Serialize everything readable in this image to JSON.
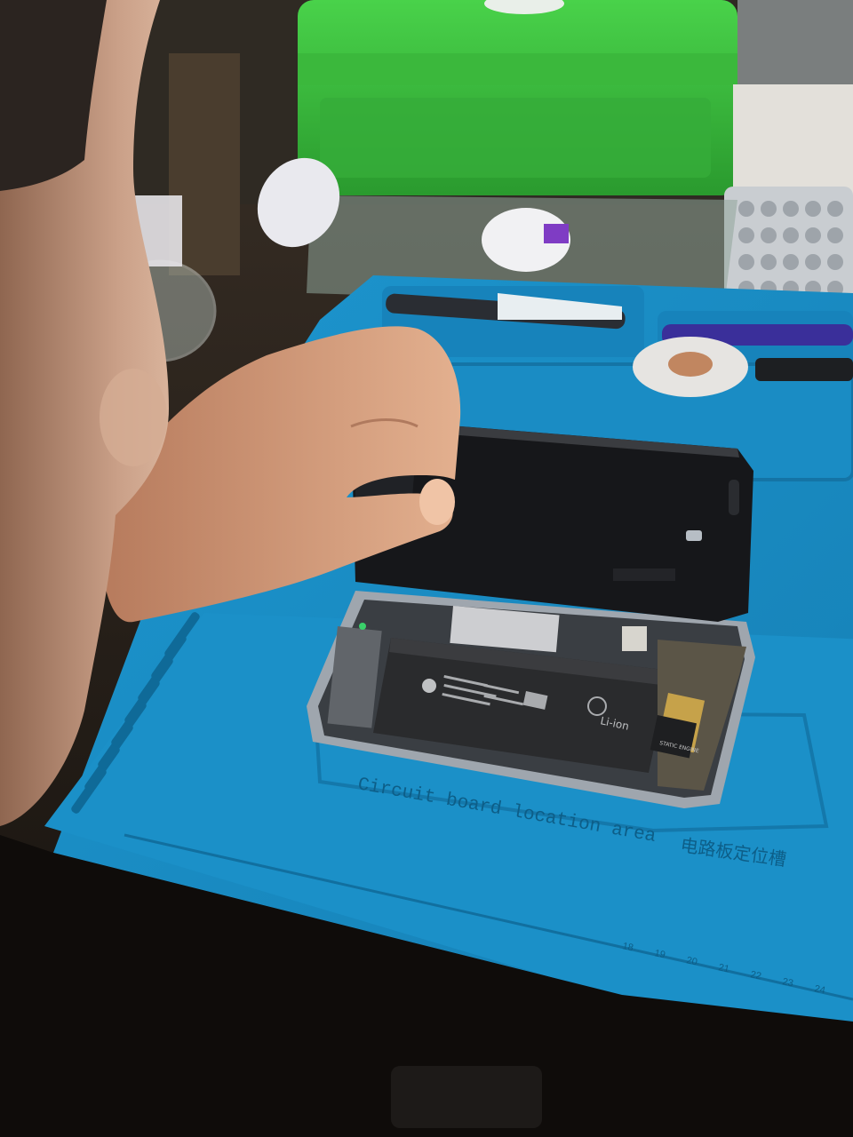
{
  "scene": {
    "subject": "Smartphone opened for repair on a silicone work mat",
    "mat_label_en": "Circuit board location area",
    "mat_label_zh": "电路板定位槽",
    "battery_markings": [
      "Li-ion"
    ],
    "chip_label": "STATIC ENGINE",
    "ruler_ticks": [
      "18",
      "19",
      "20",
      "21",
      "22",
      "23",
      "24"
    ]
  },
  "colors": {
    "mat_blue": "#1b8fc6",
    "mat_blue_dark": "#0f6a98",
    "green_box": "#3cc03f",
    "desk": "#2c241c",
    "battery": "#2a2b2d",
    "skin": "#d9a07e"
  }
}
